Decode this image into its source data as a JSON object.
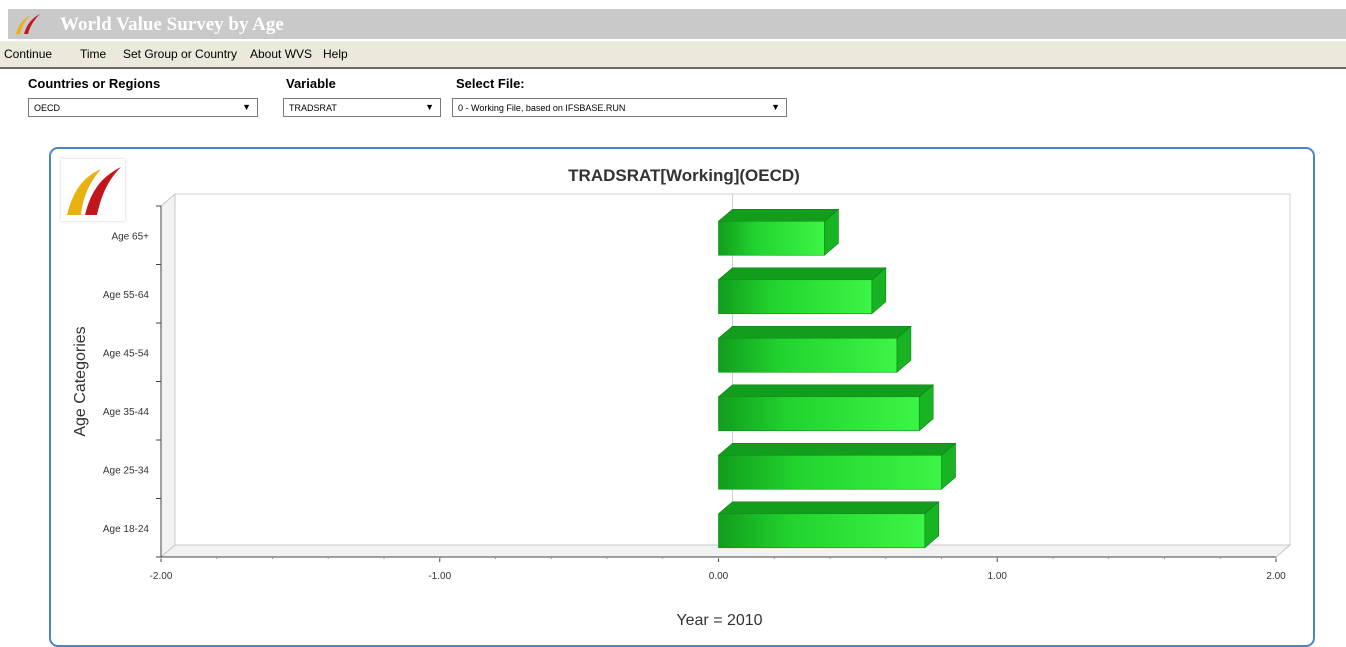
{
  "app": {
    "title": "World Value Survey by Age"
  },
  "menu": {
    "continue": "Continue",
    "time": "Time",
    "set_group": "Set Group or Country",
    "about": "About WVS",
    "help": "Help"
  },
  "filters": {
    "countries_label": "Countries or Regions",
    "countries_value": "OECD",
    "variable_label": "Variable",
    "variable_value": "TRADSRAT",
    "file_label": "Select File:",
    "file_value": "0 - Working File, based on IFSBASE.RUN"
  },
  "colors": {
    "bar": "#22d32e",
    "bar_dark": "#129d1d",
    "panel_border": "#4f84c4"
  },
  "chart_data": {
    "type": "bar",
    "orientation": "horizontal",
    "three_d": true,
    "title": "TRADSRAT[Working](OECD)",
    "ylabel": "Age Categories",
    "xlabel": "Year =  2010",
    "categories": [
      "Age 65+",
      "Age 55-64",
      "Age 45-54",
      "Age 35-44",
      "Age 25-34",
      "Age 18-24"
    ],
    "values": [
      0.38,
      0.55,
      0.64,
      0.72,
      0.8,
      0.74
    ],
    "xlim": [
      -2.0,
      2.0
    ],
    "xticks": [
      -2.0,
      -1.0,
      0.0,
      1.0,
      2.0
    ],
    "xtick_labels": [
      "-2.00",
      "-1.00",
      "0.00",
      "1.00",
      "2.00"
    ],
    "grid": false,
    "legend": "none"
  }
}
